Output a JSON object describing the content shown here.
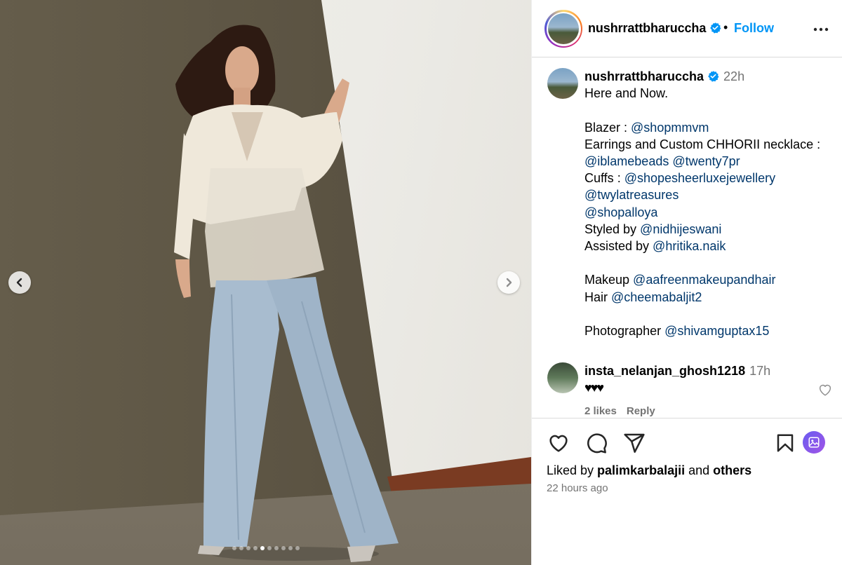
{
  "post": {
    "username": "nushrrattbharuccha",
    "verified": true,
    "follow_label": "Follow",
    "dot": "•"
  },
  "caption": {
    "username": "nushrrattbharuccha",
    "time": "22h",
    "lines": [
      [
        {
          "t": "Here and Now.",
          "m": false
        }
      ],
      [],
      [
        {
          "t": "Blazer : ",
          "m": false
        },
        {
          "t": "@shopmmvm",
          "m": true
        }
      ],
      [
        {
          "t": "Earrings and Custom CHHORII necklace :",
          "m": false
        }
      ],
      [
        {
          "t": "@iblamebeads",
          "m": true
        },
        {
          "t": " ",
          "m": false
        },
        {
          "t": "@twenty7pr",
          "m": true
        }
      ],
      [
        {
          "t": "Cuffs : ",
          "m": false
        },
        {
          "t": "@shopesheerluxejewellery",
          "m": true
        }
      ],
      [
        {
          "t": "@twylatreasures",
          "m": true
        }
      ],
      [
        {
          "t": "@shopalloya",
          "m": true
        }
      ],
      [
        {
          "t": "Styled by ",
          "m": false
        },
        {
          "t": "@nidhijeswani",
          "m": true
        }
      ],
      [
        {
          "t": "Assisted by ",
          "m": false
        },
        {
          "t": "@hritika.naik",
          "m": true
        }
      ],
      [],
      [
        {
          "t": "Makeup ",
          "m": false
        },
        {
          "t": "@aafreenmakeupandhair",
          "m": true
        }
      ],
      [
        {
          "t": "Hair ",
          "m": false
        },
        {
          "t": "@cheemabaljit2",
          "m": true
        }
      ],
      [],
      [
        {
          "t": "Photographer ",
          "m": false
        },
        {
          "t": "@shivamguptax15",
          "m": true
        }
      ]
    ]
  },
  "comment": {
    "username": "insta_nelanjan_ghosh1218",
    "time": "17h",
    "text": "♥♥♥",
    "likes": "2 likes",
    "reply": "Reply"
  },
  "footer": {
    "liked_by_prefix": "Liked by ",
    "liked_by_user": "palimkarbalajii",
    "liked_by_and": " and ",
    "liked_by_others": "others",
    "time_ago": "22 hours ago"
  },
  "carousel": {
    "total": 10,
    "active_index": 4
  },
  "icons": {
    "prev": "chevron-left-icon",
    "next": "chevron-right-icon",
    "more": "more-horizontal-icon",
    "like": "heart-icon",
    "comment": "comment-icon",
    "share": "send-icon",
    "save": "bookmark-icon",
    "gallery": "image-icon",
    "verified": "verified-badge-icon"
  },
  "colors": {
    "follow": "#0095f6",
    "mention": "#00376b",
    "secondary_text": "#737373",
    "verified": "#0095f6"
  }
}
